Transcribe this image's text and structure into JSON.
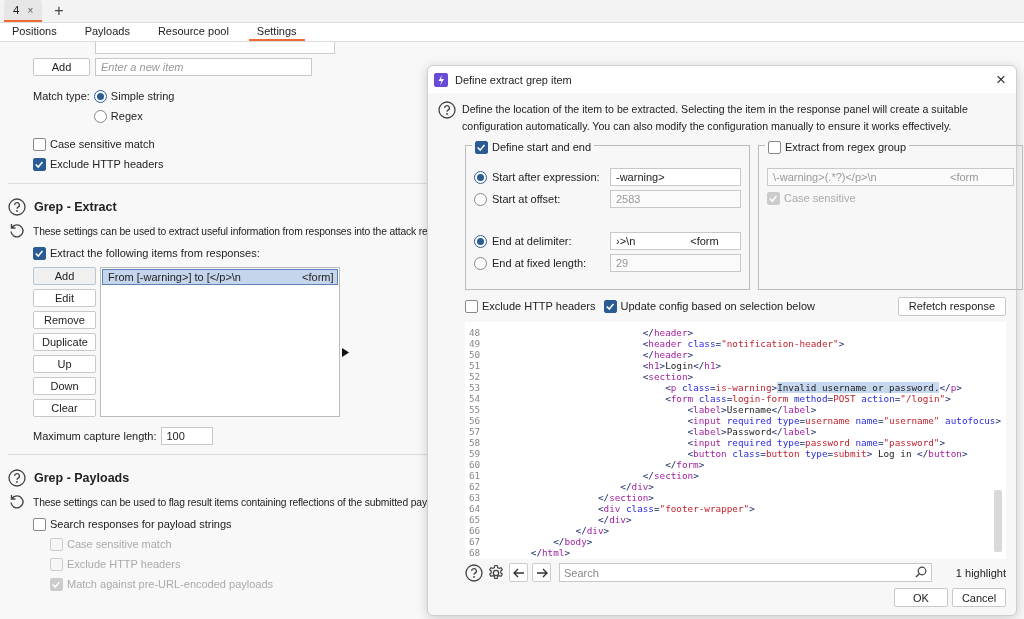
{
  "top_tabs": [
    {
      "label": "4",
      "close": "×",
      "selected": true
    }
  ],
  "new_tab": "+",
  "sub_tabs": [
    {
      "label": "Positions",
      "selected": false
    },
    {
      "label": "Payloads",
      "selected": false
    },
    {
      "label": "Resource pool",
      "selected": false
    },
    {
      "label": "Settings",
      "selected": true
    }
  ],
  "item_input": {
    "button": "Add",
    "placeholder": "Enter a new item"
  },
  "match_type": {
    "label": "Match type:",
    "options": [
      {
        "label": "Simple string",
        "selected": true
      },
      {
        "label": "Regex",
        "selected": false
      }
    ]
  },
  "match_options": [
    {
      "label": "Case sensitive match",
      "checked": false
    },
    {
      "label": "Exclude HTTP headers",
      "checked": true
    }
  ],
  "grep_extract": {
    "title": "Grep - Extract",
    "description": "These settings can be used to extract useful information from responses into the attack re",
    "extract": {
      "label": "Extract the following items from responses:",
      "checked": true
    },
    "buttons": [
      {
        "label": "Add",
        "highlighted": true
      },
      {
        "label": "Edit",
        "highlighted": false
      },
      {
        "label": "Remove",
        "highlighted": false
      },
      {
        "label": "Duplicate",
        "highlighted": false
      },
      {
        "label": "Up",
        "highlighted": false
      },
      {
        "label": "Down",
        "highlighted": false
      },
      {
        "label": "Clear",
        "highlighted": false
      }
    ],
    "items": [
      {
        "text": "From [-warning>] to [</p>\\n                    <form]",
        "selected": true
      }
    ],
    "max_length": {
      "label": "Maximum capture length:",
      "value": "100"
    }
  },
  "grep_payloads": {
    "title": "Grep - Payloads",
    "description": "These settings can be used to flag result items containing reflections of the submitted pay",
    "search": {
      "label": "Search responses for payload strings",
      "checked": false
    },
    "options": [
      {
        "label": "Case sensitive match",
        "checked": false,
        "disabled": true
      },
      {
        "label": "Exclude HTTP headers",
        "checked": false,
        "disabled": true
      },
      {
        "label": "Match against pre-URL-encoded payloads",
        "checked": true,
        "disabled": true
      }
    ]
  },
  "dialog": {
    "title": "Define extract grep item",
    "close": "×",
    "description": "Define the location of the item to be extracted. Selecting the item in the response panel will create a suitable configuration automatically. You can also modify the configuration manually to ensure it works effectively.",
    "start_end": {
      "label": "Define start and end",
      "checked": true,
      "start": [
        {
          "label": "Start after expression:",
          "value": "-warning>",
          "selected": true
        },
        {
          "label": "Start at offset:",
          "value": "2583",
          "selected": false
        }
      ],
      "end": [
        {
          "label": "End at delimiter:",
          "value": "›>\\n                  <form",
          "selected": true
        },
        {
          "label": "End at fixed length:",
          "value": "29",
          "selected": false
        }
      ]
    },
    "regex": {
      "label": "Extract from regex group",
      "checked": false,
      "value": "\\-warning>(.*?)</p>\\n                        <form",
      "case_sensitive": {
        "label": "Case sensitive",
        "checked": true
      }
    },
    "options": [
      {
        "label": "Exclude HTTP headers",
        "checked": false
      },
      {
        "label": "Update config based on selection below",
        "checked": true
      }
    ],
    "refetch": "Refetch response",
    "code": [
      {
        "number": "48",
        "parts": [
          {
            "text": "                            </header>",
            "selected": false
          }
        ]
      },
      {
        "number": "49",
        "parts": [
          {
            "text": "                            <header class=\"notification-header\">",
            "selected": false
          }
        ]
      },
      {
        "number": "50",
        "parts": [
          {
            "text": "                            </header>",
            "selected": false
          }
        ]
      },
      {
        "number": "51",
        "parts": [
          {
            "text": "                            <h1>Login</h1>",
            "selected": false
          }
        ]
      },
      {
        "number": "52",
        "parts": [
          {
            "text": "                            <section>",
            "selected": false
          }
        ]
      },
      {
        "number": "53",
        "parts": [
          {
            "text": "                                <p class=is-warning>",
            "selected": false
          },
          {
            "text": "Invalid username or password.",
            "selected": true
          },
          {
            "text": "</p>",
            "selected": false
          }
        ]
      },
      {
        "number": "54",
        "parts": [
          {
            "text": "                                <form class=login-form method=POST action=\"/login\">",
            "selected": false
          }
        ]
      },
      {
        "number": "55",
        "parts": [
          {
            "text": "                                    <label>Username</label>",
            "selected": false
          }
        ]
      },
      {
        "number": "56",
        "parts": [
          {
            "text": "                                    <input required type=username name=\"username\" autofocus>",
            "selected": false
          }
        ]
      },
      {
        "number": "57",
        "parts": [
          {
            "text": "                                    <label>Password</label>",
            "selected": false
          }
        ]
      },
      {
        "number": "58",
        "parts": [
          {
            "text": "                                    <input required type=password name=\"password\">",
            "selected": false
          }
        ]
      },
      {
        "number": "59",
        "parts": [
          {
            "text": "                                    <button class=button type=submit> Log in </button>",
            "selected": false
          }
        ]
      },
      {
        "number": "60",
        "parts": [
          {
            "text": "                                </form>",
            "selected": false
          }
        ]
      },
      {
        "number": "61",
        "parts": [
          {
            "text": "                            </section>",
            "selected": false
          }
        ]
      },
      {
        "number": "62",
        "parts": [
          {
            "text": "                        </div>",
            "selected": false
          }
        ]
      },
      {
        "number": "63",
        "parts": [
          {
            "text": "                    </section>",
            "selected": false
          }
        ]
      },
      {
        "number": "64",
        "parts": [
          {
            "text": "                    <div class=\"footer-wrapper\">",
            "selected": false
          }
        ]
      },
      {
        "number": "65",
        "parts": [
          {
            "text": "                    </div>",
            "selected": false
          }
        ]
      },
      {
        "number": "66",
        "parts": [
          {
            "text": "                </div>",
            "selected": false
          }
        ]
      },
      {
        "number": "67",
        "parts": [
          {
            "text": "            </body>",
            "selected": false
          }
        ]
      },
      {
        "number": "68",
        "parts": [
          {
            "text": "        </html>",
            "selected": false
          }
        ]
      }
    ],
    "search_placeholder": "Search",
    "highlights": "1 highlight",
    "buttons": [
      "OK",
      "Cancel"
    ]
  }
}
